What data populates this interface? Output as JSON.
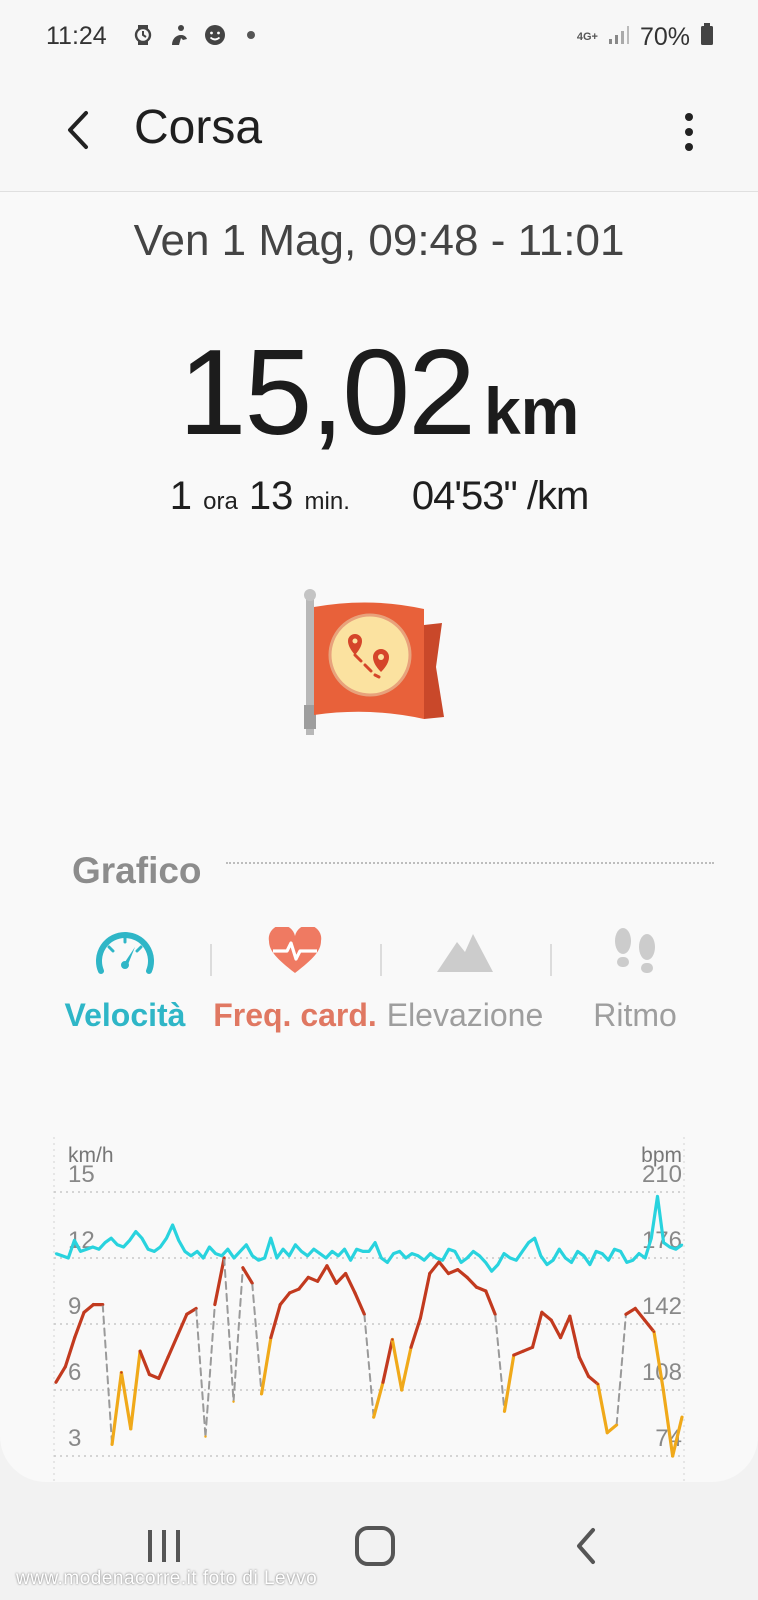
{
  "status_bar": {
    "time": "11:24",
    "network": "4G+",
    "battery": "70%",
    "icons": [
      "watch-icon",
      "fitness-icon",
      "face-icon",
      "notification-dot-icon"
    ]
  },
  "header": {
    "title": "Corsa",
    "back_icon": "chevron-left-icon",
    "menu_icon": "more-vertical-icon"
  },
  "workout": {
    "date_range": "Ven 1 Mag, 09:48 - 11:01",
    "distance_value": "15,02",
    "distance_unit": "km",
    "duration_h": "1",
    "duration_h_unit": "ora",
    "duration_m": "13",
    "duration_m_unit": "min.",
    "pace": "04'53\" /km",
    "badge_icon": "route-flag-icon"
  },
  "graph_section": {
    "title": "Grafico",
    "tabs": [
      {
        "label": "Velocità",
        "icon": "speedometer-icon",
        "color": "#2fb6c7"
      },
      {
        "label": "Freq. card.",
        "icon": "heart-rate-icon",
        "color": "#e07862"
      },
      {
        "label": "Elevazione",
        "icon": "mountain-icon",
        "color": "#9e9e9e"
      },
      {
        "label": "Ritmo",
        "icon": "footsteps-icon",
        "color": "#9e9e9e"
      }
    ]
  },
  "chart_data": {
    "type": "line",
    "left_axis_label": "km/h",
    "right_axis_label": "bpm",
    "left_ticks": [
      "15",
      "12",
      "9",
      "6",
      "3"
    ],
    "right_ticks": [
      "210",
      "176",
      "142",
      "108",
      "74"
    ],
    "left_range": [
      3,
      15
    ],
    "right_range": [
      74,
      210
    ],
    "series": [
      {
        "axis": "left",
        "color": "#29d3de",
        "values": [
          12.2,
          12.1,
          12.0,
          12.8,
          12.3,
          12.4,
          12.5,
          12.4,
          12.7,
          12.9,
          12.6,
          12.5,
          12.8,
          13.2,
          12.9,
          12.4,
          12.3,
          12.5,
          12.9,
          13.5,
          12.8,
          12.3,
          12.1,
          12.3,
          12.0,
          12.5,
          12.2,
          12.1,
          12.4,
          12.0,
          12.3,
          12.6,
          12.1,
          11.9,
          12.0,
          12.9,
          12.0,
          12.4,
          12.1,
          12.6,
          12.3,
          12.1,
          12.4,
          12.2,
          12.0,
          12.3,
          12.1,
          12.4,
          11.9,
          12.4,
          12.3,
          12.3,
          12.7,
          12.0,
          11.8,
          12.2,
          12.3,
          12.0,
          12.2,
          12.1,
          11.9,
          12.2,
          12.0,
          11.9,
          12.4,
          12.3,
          11.8,
          12.0,
          12.3,
          12.1,
          11.8,
          11.4,
          11.7,
          12.2,
          12.0,
          11.9,
          12.3,
          12.7,
          12.9,
          12.1,
          11.7,
          11.9,
          12.4,
          12.0,
          11.8,
          12.3,
          12.1,
          11.7,
          12.3,
          12.2,
          11.9,
          12.4,
          12.3,
          11.8,
          11.9,
          12.2,
          12.0,
          12.9,
          14.8,
          12.7,
          12.5,
          12.4,
          12.6
        ],
        "interval_s": 43
      },
      {
        "axis": "right",
        "color": "#c23a1f",
        "low_color": "#f0a91a",
        "values": [
          112,
          120,
          135,
          148,
          152,
          152,
          80,
          117,
          88,
          128,
          116,
          114,
          125,
          136,
          147,
          150,
          84,
          152,
          176,
          102,
          171,
          163,
          106,
          135,
          152,
          158,
          160,
          166,
          164,
          172,
          163,
          168,
          158,
          147,
          94,
          112,
          134,
          108,
          130,
          145,
          168,
          174,
          168,
          170,
          166,
          161,
          159,
          147,
          97,
          126,
          128,
          130,
          148,
          144,
          135,
          146,
          125,
          115,
          111,
          86,
          90,
          147,
          150,
          144,
          138,
          108,
          74,
          94
        ],
        "note": "gaps/dashed connectors between segments rendered from the same values"
      }
    ]
  },
  "nav_bar": {
    "recent_icon": "recent-apps-icon",
    "home_icon": "home-icon",
    "back_icon": "nav-back-icon"
  },
  "watermark": "www.modenacorre.it foto di Levvo"
}
